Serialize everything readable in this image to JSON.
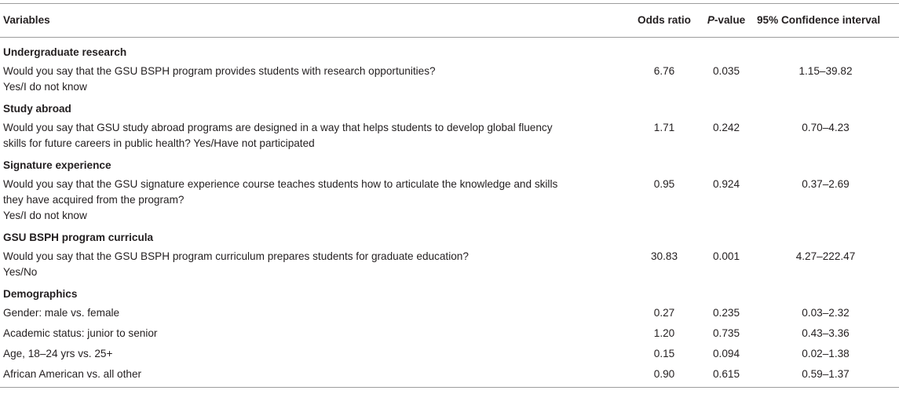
{
  "headers": {
    "variables": "Variables",
    "odds_ratio": "Odds ratio",
    "p_value_prefix": "P",
    "p_value_suffix": "-value",
    "ci": "95% Confidence interval"
  },
  "sections": [
    {
      "title": "Undergraduate research",
      "rows": [
        {
          "lines": [
            "Would you say that the GSU BSPH program provides students with research opportunities?",
            "Yes/I do not know"
          ],
          "odds_ratio": "6.76",
          "p_value": "0.035",
          "ci": "1.15–39.82"
        }
      ]
    },
    {
      "title": "Study abroad",
      "rows": [
        {
          "lines": [
            "Would you say that GSU study abroad programs are designed in a way that helps students to develop global fluency",
            "skills for future careers in public health? Yes/Have not participated"
          ],
          "odds_ratio": "1.71",
          "p_value": "0.242",
          "ci": "0.70–4.23"
        }
      ]
    },
    {
      "title": "Signature experience",
      "rows": [
        {
          "lines": [
            "Would you say that the GSU signature experience course teaches students how to articulate the knowledge and skills",
            "they have acquired from the program?",
            "Yes/I do not know"
          ],
          "odds_ratio": "0.95",
          "p_value": "0.924",
          "ci": "0.37–2.69"
        }
      ]
    },
    {
      "title": "GSU BSPH program curricula",
      "rows": [
        {
          "lines": [
            "Would you say that the GSU BSPH program curriculum prepares students for graduate education?",
            "Yes/No"
          ],
          "odds_ratio": "30.83",
          "p_value": "0.001",
          "ci": "4.27–222.47"
        }
      ]
    },
    {
      "title": "Demographics",
      "rows": [
        {
          "lines": [
            "Gender: male vs. female"
          ],
          "odds_ratio": "0.27",
          "p_value": "0.235",
          "ci": "0.03–2.32"
        },
        {
          "lines": [
            "Academic status: junior to senior"
          ],
          "odds_ratio": "1.20",
          "p_value": "0.735",
          "ci": "0.43–3.36"
        },
        {
          "lines": [
            "Age, 18–24 yrs vs. 25+"
          ],
          "odds_ratio": "0.15",
          "p_value": "0.094",
          "ci": "0.02–1.38"
        },
        {
          "lines": [
            "African American vs. all other"
          ],
          "odds_ratio": "0.90",
          "p_value": "0.615",
          "ci": "0.59–1.37"
        }
      ]
    }
  ]
}
